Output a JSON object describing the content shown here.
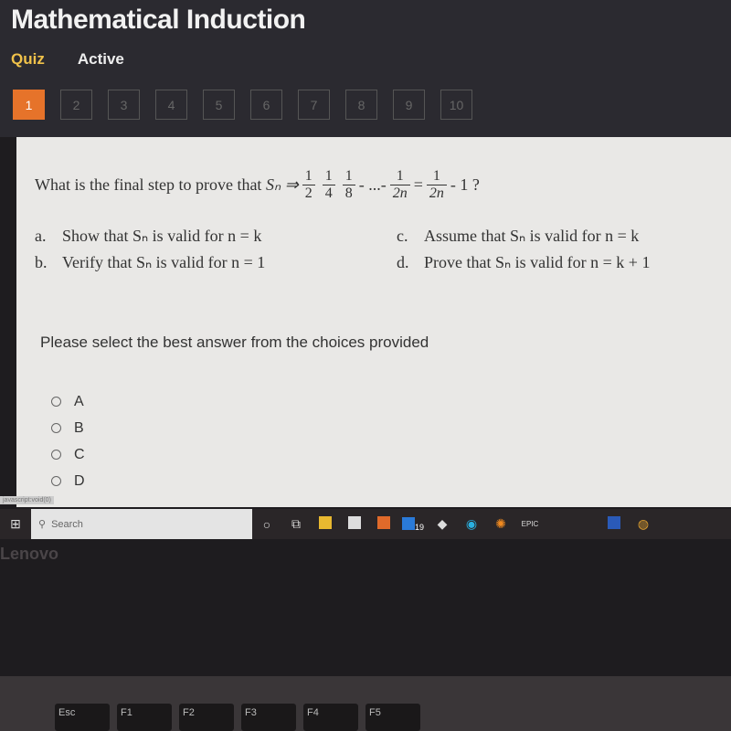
{
  "header": {
    "title": "Mathematical Induction",
    "tabs": [
      "Quiz",
      "Active"
    ]
  },
  "question_nav": {
    "numbers": [
      "1",
      "2",
      "3",
      "4",
      "5",
      "6",
      "7",
      "8",
      "9",
      "10"
    ],
    "active": "1"
  },
  "question": {
    "text": "What is the final step to prove that",
    "sn": "Sₙ ⇒",
    "fractions": [
      {
        "num": "1",
        "den": "2"
      },
      {
        "num": "1",
        "den": "4"
      },
      {
        "num": "1",
        "den": "8"
      }
    ],
    "ellipsis": "- ...-",
    "last_frac": {
      "num": "1",
      "den": "2n"
    },
    "equals": "=",
    "rhs_frac": {
      "num": "1",
      "den": "2n"
    },
    "tail": "- 1 ?"
  },
  "choices": [
    {
      "letter": "a.",
      "text": "Show that Sₙ is valid for n = k"
    },
    {
      "letter": "b.",
      "text": "Verify that Sₙ is valid for n = 1"
    },
    {
      "letter": "c.",
      "text": "Assume that Sₙ is valid for n = k"
    },
    {
      "letter": "d.",
      "text": "Prove that Sₙ is valid for n = k + 1"
    }
  ],
  "prompt": "Please select the best answer from the choices provided",
  "radio_options": [
    "A",
    "B",
    "C",
    "D"
  ],
  "status_url": "javascript:void(0)",
  "taskbar": {
    "search_placeholder": "Search",
    "mail_badge": "19",
    "icons": [
      "cortana-icon",
      "task-view-icon",
      "file-explorer-icon",
      "store-icon",
      "app-icon",
      "mail-icon",
      "eraser-app-icon",
      "edge-icon",
      "blender-icon",
      "epic-games-icon",
      "word-icon",
      "chrome-icon"
    ]
  },
  "bezel": {
    "brand": "Lenovo"
  },
  "keyboard": {
    "keys": [
      "Esc",
      "F1",
      "F2",
      "F3",
      "F4",
      "F5"
    ]
  },
  "colors": {
    "accent": "#e6732a",
    "tab_active": "#f0c24a"
  }
}
